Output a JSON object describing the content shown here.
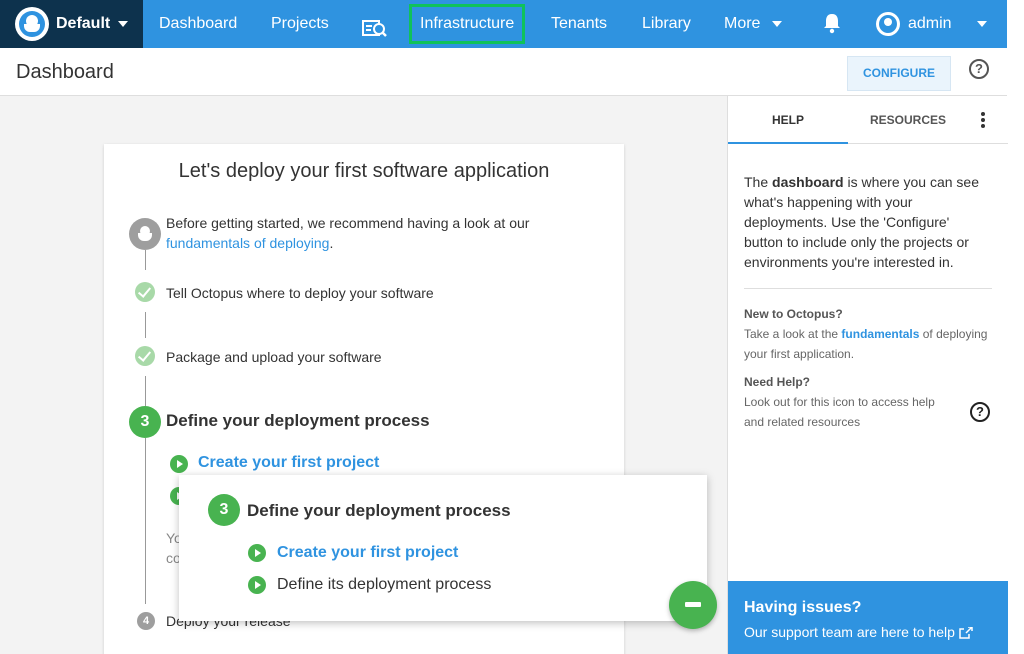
{
  "topnav": {
    "space": "Default",
    "items": {
      "dashboard": "Dashboard",
      "projects": "Projects",
      "infrastructure": "Infrastructure",
      "tenants": "Tenants",
      "library": "Library",
      "more": "More"
    },
    "user": "admin"
  },
  "subheader": {
    "title": "Dashboard",
    "configure": "CONFIGURE",
    "help_icon": "?"
  },
  "card": {
    "title": "Let's deploy your first software application",
    "intro_text": "Before getting started, we recommend having a look at our",
    "intro_link": "fundamentals of deploying",
    "intro_end": ".",
    "step1": "Tell Octopus where to deploy your software",
    "step2": "Package and upload your software",
    "step3_num": "3",
    "step3": "Define your deployment process",
    "step3_sub1": "Create your first project",
    "partial_1": "Yo",
    "partial_2": "co",
    "step4_num": "4",
    "step4": "Deploy your release"
  },
  "popup": {
    "num": "3",
    "title": "Define your deployment process",
    "sub1": "Create your first project",
    "sub2": "Define its deployment process"
  },
  "help_panel": {
    "tab_help": "HELP",
    "tab_resources": "RESOURCES",
    "body_1": "The ",
    "body_bold": "dashboard",
    "body_2": " is where you can see what's happening with your deployments. Use the 'Configure' button to include only the projects or environments you're interested in.",
    "new_title": "New to Octopus?",
    "new_1": "Take a look at the ",
    "new_link": "fundamentals",
    "new_2": " of deploying your first application.",
    "need_title": "Need Help?",
    "need_text": "Look out for this icon to access help and related resources",
    "need_icon": "?",
    "issues_title": "Having issues?",
    "issues_sub": "Our support team are here to help"
  },
  "icons": {
    "logo": "octopus-logo-icon",
    "bell": "bell-icon",
    "search": "search-icon",
    "avatar": "avatar-icon",
    "external": "external-link-icon",
    "fab": "minus-icon"
  },
  "colors": {
    "nav_blue": "#2f93e0",
    "space_dark": "#0d324d",
    "green": "#48b350",
    "highlight": "#10c25a"
  }
}
